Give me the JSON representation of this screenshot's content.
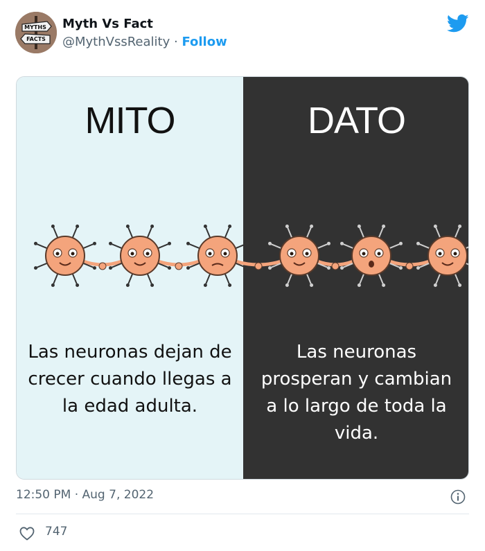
{
  "tweet": {
    "avatar": {
      "text_top": "MYTHS",
      "text_bottom": "FACTS"
    },
    "author_name": "Myth Vs Fact",
    "handle": "@MythVssReality",
    "separator": "·",
    "follow_label": "Follow",
    "timestamp": "12:50 PM · Aug 7, 2022",
    "likes": "747"
  },
  "image": {
    "myth": {
      "title": "MITO",
      "text": "Las neuronas dejan de crecer cuando llegas a la edad adulta."
    },
    "fact": {
      "title": "DATO",
      "text": "Las neuronas prosperan y cambian a lo largo de toda la vida."
    },
    "colors": {
      "myth_bg": "#e4f4f7",
      "fact_bg": "#323232",
      "neuron": "#f4a47c"
    }
  },
  "icons": [
    "twitter-bird-icon",
    "info-icon",
    "heart-icon"
  ],
  "colors": {
    "accent": "#1d9bf0",
    "text_secondary": "#536471"
  }
}
